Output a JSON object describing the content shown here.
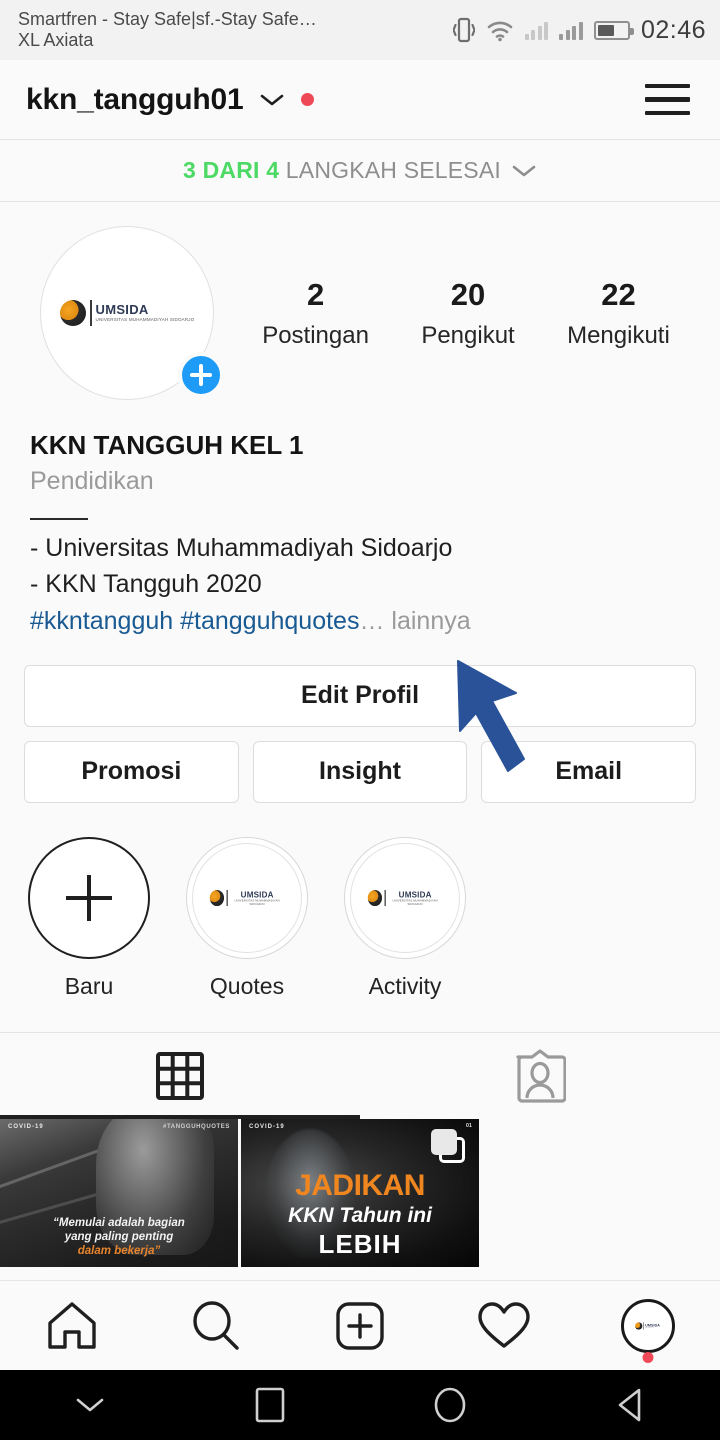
{
  "status_bar": {
    "carrier_line1": "Smartfren - Stay Safe|sf.-Stay Safe…",
    "carrier_line2": "XL Axiata",
    "time": "02:46",
    "icons": [
      "vibrate-icon",
      "wifi-icon",
      "signal-bars-icon",
      "signal-bars-icon",
      "battery-icon"
    ]
  },
  "header": {
    "username": "kkn_tangguh01",
    "chevron": "⌄",
    "has_notification_dot": true,
    "menu_icon": "hamburger-menu-icon"
  },
  "steps_banner": {
    "highlight": "3 DARI 4",
    "rest": "LANGKAH SELESAI",
    "chevron": "⌄",
    "highlight_color": "#4cd964"
  },
  "profile": {
    "avatar_alt": "UMSIDA",
    "add_story_label": "+",
    "stats": [
      {
        "value": "2",
        "label": "Postingan"
      },
      {
        "value": "20",
        "label": "Pengikut"
      },
      {
        "value": "22",
        "label": "Mengikuti"
      }
    ],
    "display_name": "KKN TANGGUH KEL 1",
    "category": "Pendidikan",
    "bio_line1": "- Universitas Muhammadiyah Sidoarjo",
    "bio_line2": "- KKN Tangguh 2020",
    "bio_tags": "#kkntangguh #tangguhquotes",
    "bio_more_ellipsis": "…",
    "bio_more": " lainnya"
  },
  "actions": {
    "edit_profile": "Edit Profil",
    "promosi": "Promosi",
    "insight": "Insight",
    "email": "Email"
  },
  "highlights": [
    {
      "label": "Baru",
      "type": "new"
    },
    {
      "label": "Quotes",
      "type": "cover"
    },
    {
      "label": "Activity",
      "type": "cover"
    }
  ],
  "tabs": [
    {
      "name": "grid-tab",
      "icon": "grid-icon",
      "active": true
    },
    {
      "name": "tagged-tab",
      "icon": "tagged-icon",
      "active": false
    }
  ],
  "posts": [
    {
      "badge_topleft": "COVID-19",
      "badge_topright": "#TANGGUHQUOTES",
      "caption_line1": "“Memulai adalah bagian",
      "caption_line2": "yang paling penting",
      "caption_line3": "dalam bekerja”",
      "accent_color": "#e8842c",
      "is_carousel": false
    },
    {
      "badge_topleft": "COVID-19",
      "badge_index": "01",
      "title": "JADIKAN",
      "subtitle": "KKN Tahun ini",
      "subtitle2": "LEBIH",
      "accent_color": "#f0861f",
      "is_carousel": true
    }
  ],
  "bottom_nav": [
    {
      "name": "home-nav",
      "icon": "home-icon"
    },
    {
      "name": "search-nav",
      "icon": "search-icon"
    },
    {
      "name": "add-nav",
      "icon": "plus-square-icon"
    },
    {
      "name": "activity-nav",
      "icon": "heart-icon"
    },
    {
      "name": "profile-nav",
      "icon": "profile-avatar-icon",
      "has_dot": true
    }
  ],
  "android_nav": [
    {
      "name": "hide-keyboard-button",
      "icon": "chevron-down-icon"
    },
    {
      "name": "recents-button",
      "icon": "square-icon"
    },
    {
      "name": "home-button",
      "icon": "circle-icon"
    },
    {
      "name": "back-button",
      "icon": "triangle-left-icon"
    }
  ],
  "cursor": {
    "color": "#2a5298",
    "type": "arrow-pointer"
  }
}
